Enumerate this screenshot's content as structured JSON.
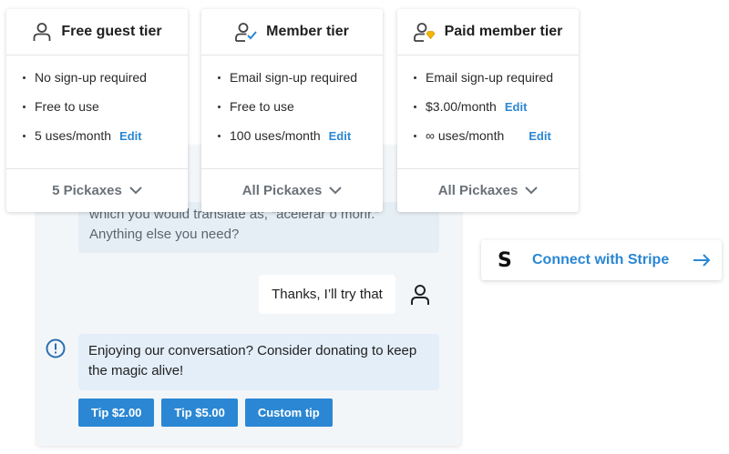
{
  "tiers": [
    {
      "title": "Free guest tier",
      "icon": "person-icon",
      "features": [
        "No sign-up required",
        "Free to use",
        "5 uses/month"
      ],
      "edit_label": "Edit",
      "footer": "5 Pickaxes"
    },
    {
      "title": "Member tier",
      "icon": "person-check-icon",
      "features": [
        "Email sign-up required",
        "Free to use",
        "100 uses/month"
      ],
      "edit_label": "Edit",
      "footer": "All Pickaxes"
    },
    {
      "title": "Paid member tier",
      "icon": "person-gem-icon",
      "features": [
        "Email sign-up required",
        "$3.00/month",
        "∞ uses/month"
      ],
      "edit_label": "Edit",
      "footer": "All Pickaxes"
    }
  ],
  "chat": {
    "bot_line1": "which you would translate as, “acelerar o morir.”",
    "bot_line2": "Anything else you need?",
    "user_message": "Thanks, I’ll try that",
    "notice": "Enjoying our conversation? Consider donating to keep the magic alive!",
    "tips": [
      "Tip $2.00",
      "Tip $5.00",
      "Custom tip"
    ]
  },
  "stripe": {
    "logo": "S",
    "label": "Connect with Stripe"
  },
  "colors": {
    "accent": "#2b87d3",
    "gem": "#f2b705"
  }
}
